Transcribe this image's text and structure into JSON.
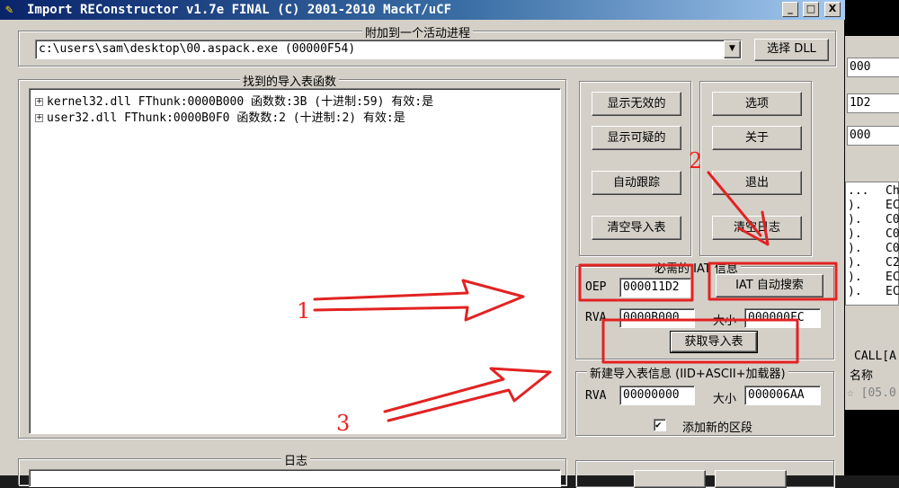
{
  "window": {
    "title": "Import REConstructor v1.7e FINAL (C) 2001-2010 MackT/uCF",
    "controls": [
      "_",
      "□",
      "X"
    ]
  },
  "attach": {
    "legend": "附加到一个活动进程",
    "process": "c:\\users\\sam\\desktop\\00.aspack.exe (00000F54)",
    "pick_dll": "选择 DLL"
  },
  "imports": {
    "legend": "找到的导入表函数",
    "nodes": [
      "kernel32.dll FThunk:0000B000 函数数:3B (十进制:59) 有效:是",
      "user32.dll FThunk:0000B0F0 函数数:2 (十进制:2) 有效:是"
    ]
  },
  "buttons": {
    "show_invalid": "显示无效的",
    "show_suspect": "显示可疑的",
    "auto_trace": "自动跟踪",
    "clear_imports": "清空导入表",
    "options": "选项",
    "about": "关于",
    "exit": "退出",
    "clear_log": "清空日志"
  },
  "iat": {
    "legend": "必需的 IAT 信息",
    "oep_label": "OEP",
    "oep": "000011D2",
    "auto_search": "IAT 自动搜索",
    "rva_label": "RVA",
    "rva": "0000B000",
    "size_label": "大小",
    "size": "000000FC",
    "get_imports": "获取导入表"
  },
  "new_import": {
    "legend": "新建导入表信息 (IID+ASCII+加载器)",
    "rva_label": "RVA",
    "rva": "00000000",
    "size_label": "大小",
    "size": "000006AA",
    "add_section_label": "添加新的区段",
    "add_section_checked": true,
    "check_mark": "✔"
  },
  "log": {
    "legend": "日志"
  },
  "annotations": {
    "one": "1",
    "two": "2",
    "three": "3",
    "color": "#e22222"
  },
  "background_window": {
    "fields": [
      "000",
      "1D2",
      "000"
    ],
    "col_header_a": "...",
    "col_header_b": "Ch",
    "col_a": [
      ").",
      ").",
      ").",
      ").",
      ").",
      ").",
      ")."
    ],
    "col_b": [
      "EC",
      "C0",
      "C0",
      "C0",
      "C2",
      "EC",
      "EC"
    ],
    "call_text": "CALL[A",
    "name_text": "名称",
    "date_text": "☆ [05.0"
  }
}
